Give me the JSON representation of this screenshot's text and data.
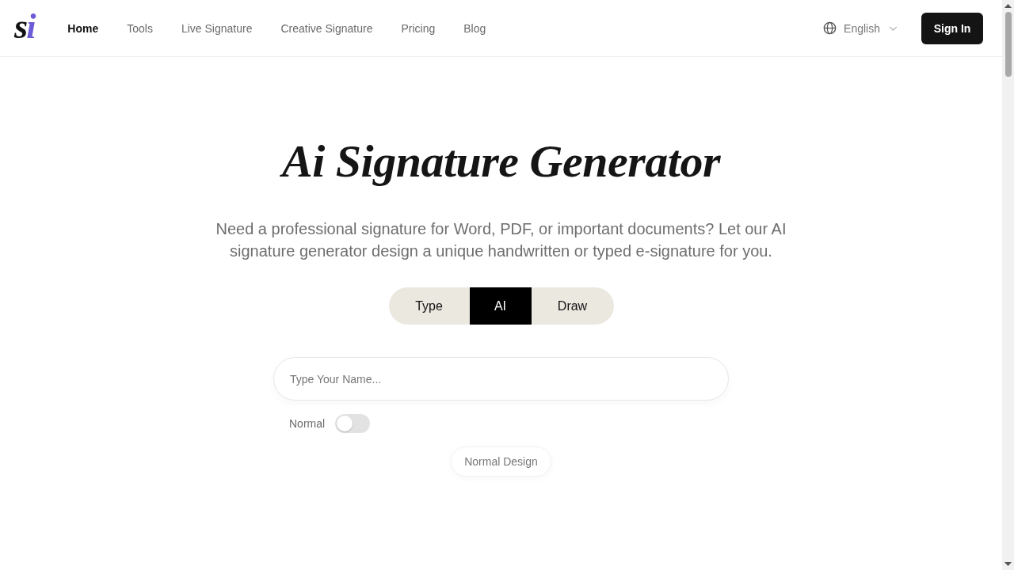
{
  "logo": {
    "text": "si"
  },
  "nav": [
    {
      "label": "Home",
      "selected": true
    },
    {
      "label": "Tools",
      "selected": false
    },
    {
      "label": "Live Signature",
      "selected": false
    },
    {
      "label": "Creative Signature",
      "selected": false
    },
    {
      "label": "Pricing",
      "selected": false
    },
    {
      "label": "Blog",
      "selected": false
    }
  ],
  "language": {
    "label": "English"
  },
  "sign_in": {
    "label": "Sign In"
  },
  "hero": {
    "title": "Ai Signature Generator",
    "subtitle": "Need a professional signature for Word, PDF, or important documents? Let our AI signature generator design a unique handwritten or typed e-signature for you."
  },
  "modes": [
    {
      "label": "Type",
      "selected": false
    },
    {
      "label": "AI",
      "selected": true
    },
    {
      "label": "Draw",
      "selected": false
    }
  ],
  "name_field": {
    "placeholder": "Type Your Name..."
  },
  "style_toggle": {
    "label": "Normal",
    "on": false
  },
  "design_button": {
    "label": "Normal Design"
  }
}
